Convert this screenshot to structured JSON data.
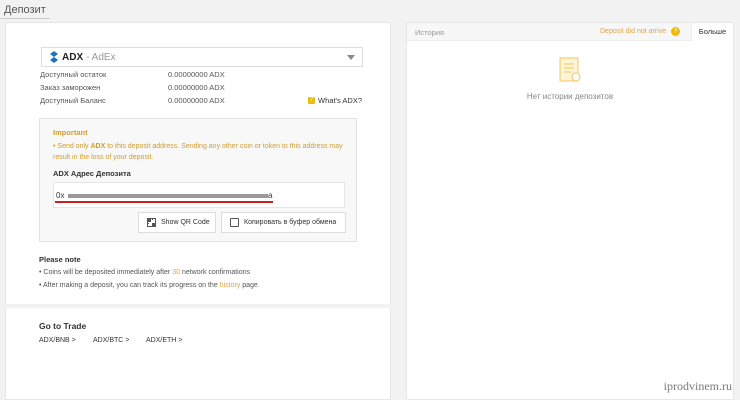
{
  "page_title": "Депозит",
  "coin": {
    "symbol": "ADX",
    "name": "- AdEx"
  },
  "balances": [
    {
      "label": "Доступный остаток",
      "value": "0.00000000 ADX"
    },
    {
      "label": "Заказ заморожен",
      "value": "0.00000000 ADX"
    },
    {
      "label": "Доступный Баланс",
      "value": "0.00000000 ADX"
    }
  ],
  "whats_link": "What's ADX?",
  "important": {
    "title": "Important",
    "text_before": "Send only ",
    "text_coin": "ADX",
    "text_after": " to this deposit address. Sending any other coin or token to this address may result in the loss of your deposit.",
    "address_label": "ADX Адрес Депозита",
    "address_prefix": "0x",
    "address_suffix": "a",
    "qr_button": "Show QR Code",
    "copy_button": "Копировать в буфер обмена"
  },
  "note": {
    "title": "Please note",
    "item1_before": "Coins will be deposited immediately after ",
    "item1_highlight": "30",
    "item1_after": " network confirmations",
    "item2_before": "After making a deposit, you can track its progress on the ",
    "item2_highlight": "history",
    "item2_after": " page."
  },
  "trade": {
    "title": "Go to Trade",
    "links": [
      "ADX/BNB >",
      "ADX/BTC >",
      "ADX/ETH >"
    ]
  },
  "history": {
    "title": "История",
    "issue_link": "Deposit did not arrive",
    "more_button": "Больше",
    "empty_text": "Нет истории депозитов"
  },
  "watermark": "iprodvinem.ru",
  "colors": {
    "accent": "#f0b90b",
    "warning_text": "#d49b2a",
    "redline": "#cc1f1f"
  }
}
